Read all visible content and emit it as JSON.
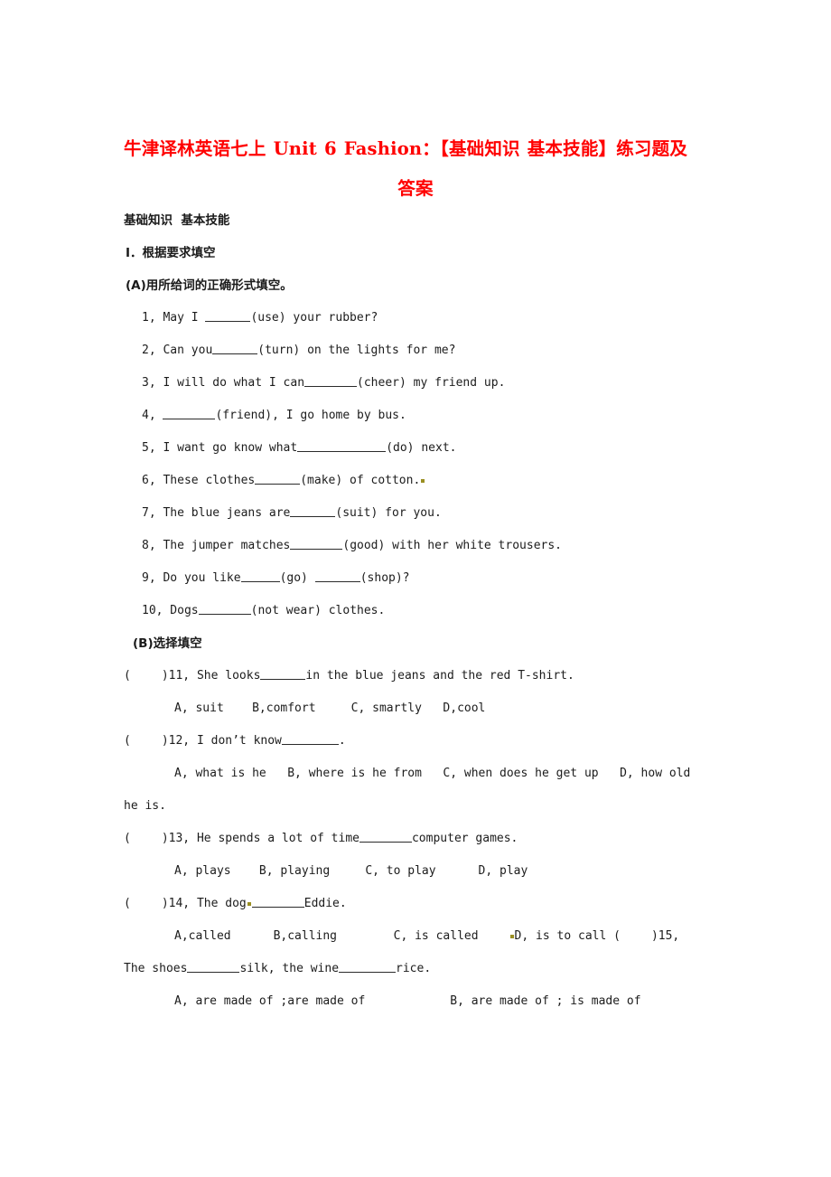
{
  "document": {
    "title_line1": "牛津译林英语七上 Unit 6 Fashion：【基础知识 基本技能】练习题及",
    "title_line2": "答案",
    "title_color": "#FF0000",
    "section_heading": "基础知识  基本技能",
    "part_one_heading": "Ⅰ．根据要求填空",
    "subsection_a": "(A)用所给词的正确形式填空。",
    "subsection_b": "(B)选择填空",
    "fill_in_blanks": [
      {
        "number": "1,",
        "pre": " May I ",
        "blank": "b6",
        "post": "(use) your rubber?"
      },
      {
        "number": "2,",
        "pre": " Can you",
        "blank": "b6",
        "post": "(turn) on the lights for me?"
      },
      {
        "number": "3,",
        "pre": " I will do what I can",
        "blank": "b7",
        "post": "(cheer) my friend up."
      },
      {
        "number": "4,",
        "pre": " ",
        "blank": "b7",
        "post": "(friend), I go home by bus."
      },
      {
        "number": "5,",
        "pre": " I want go know what",
        "blank": "b12",
        "post": "(do) next."
      },
      {
        "number": "6,",
        "pre": " These clothes",
        "blank": "b6",
        "post": "(make) of cotton.",
        "trailing_mark": true
      },
      {
        "number": "7,",
        "pre": " The blue jeans are",
        "blank": "b6",
        "post": "(suit) for you."
      },
      {
        "number": "8,",
        "pre": " The jumper matches",
        "blank": "b7",
        "post": "(good) with her white trousers."
      },
      {
        "number": "9,",
        "pre": " Do you like",
        "blank": "b5",
        "post": "(go) ",
        "blank2": "b6",
        "post2": "(shop)?"
      },
      {
        "number": "10,",
        "pre": " Dogs",
        "blank": "b7",
        "post": "(not wear) clothes."
      }
    ],
    "multiple_choice": [
      {
        "stem_open": "(",
        "stem_close": ")11, She looks",
        "stem_blank": "b6",
        "stem_post": "in the blue jeans and the red T-shirt.",
        "options": "A, suit    B,comfort     C, smartly   D,cool"
      },
      {
        "stem_open": "(",
        "stem_close": ")12, I don’t know",
        "stem_blank": "b8",
        "stem_post": ".",
        "options": "A, what is he   B, where is he from   C, when does he get up   D, how old",
        "options_cont": "he is."
      },
      {
        "stem_open": "(",
        "stem_close": ")13, He spends a lot of time",
        "stem_blank": "b7",
        "stem_post": "computer games.",
        "options": "A, plays    B, playing     C, to play      D, play"
      },
      {
        "stem_open": "(",
        "stem_close": ")14, The dog",
        "stem_mark": true,
        "stem_blank": "b7",
        "stem_post": "Eddie.",
        "options_a": "A,called      B,calling        C, is called",
        "options_mark": true,
        "options_b": "D, is to call (",
        "options_c": ")15,",
        "options_cont": "The shoes",
        "cont_blank": "b7",
        "cont_mid": "silk, the wine",
        "cont_blank2": "b8",
        "cont_end": "rice.",
        "options_last": "A, are made of ;are made of            B, are made of ; is made of"
      }
    ]
  }
}
